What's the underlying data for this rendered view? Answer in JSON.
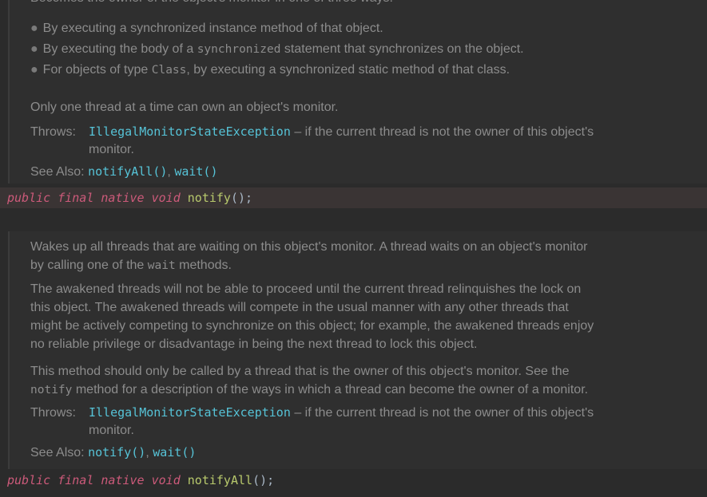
{
  "top_doc": {
    "cut_line": "Becomes the owner of the object's monitor in one of three ways:",
    "bullets": [
      {
        "pre": "By executing a synchronized instance method of that object.",
        "code": "",
        "post": ""
      },
      {
        "pre": "By executing the body of a ",
        "code": "synchronized",
        "post": " statement that synchronizes on the object."
      },
      {
        "pre": "For objects of type ",
        "code": "Class",
        "post": ", by executing a synchronized static method of that class."
      }
    ],
    "only_one": "Only one thread at a time can own an object's monitor.",
    "throws_label": "Throws:",
    "throws_exception": "IllegalMonitorStateException",
    "throws_desc_1": " – if the current thread is not the owner of this object's",
    "throws_desc_2": "monitor.",
    "see_also_label": "See Also:",
    "see_also_links": [
      "notifyAll()",
      "wait()"
    ],
    "sep": ","
  },
  "signature_1": {
    "kw1": "public",
    "kw2": "final",
    "kw3": "native",
    "kw4": "void",
    "name": "notify",
    "tail": "();"
  },
  "bottom_doc": {
    "p1_l1": "Wakes up all threads that are waiting on this object's monitor. A thread waits on an object's monitor",
    "p1_l2_pre": "by calling one of the ",
    "p1_l2_code": "wait",
    "p1_l2_post": " methods.",
    "p2_lines": [
      "The awakened threads will not be able to proceed until the current thread relinquishes the lock on",
      "this object. The awakened threads will compete in the usual manner with any other threads that",
      "might be actively competing to synchronize on this object; for example, the awakened threads enjoy",
      "no reliable privilege or disadvantage in being the next thread to lock this object."
    ],
    "p3_l1": "This method should only be called by a thread that is the owner of this object's monitor. See the",
    "p3_l2_code": "notify",
    "p3_l2_post": " method for a description of the ways in which a thread can become the owner of a monitor.",
    "throws_label": "Throws:",
    "throws_exception": "IllegalMonitorStateException",
    "throws_desc_1": " – if the current thread is not the owner of this object's",
    "throws_desc_2": "monitor.",
    "see_also_label": "See Also:",
    "see_also_links": [
      "notify()",
      "wait()"
    ],
    "sep": ","
  },
  "signature_2": {
    "kw1": "public",
    "kw2": "final",
    "kw3": "native",
    "kw4": "void",
    "name": "notifyAll",
    "tail": "();"
  }
}
